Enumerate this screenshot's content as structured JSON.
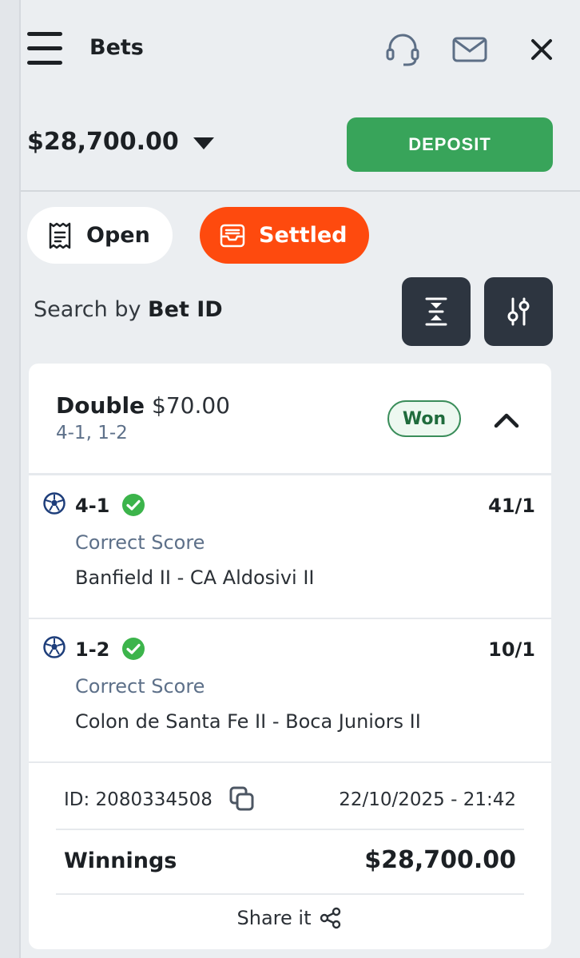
{
  "header": {
    "title": "Bets",
    "icons": [
      "menu-icon",
      "headset-icon",
      "mail-icon",
      "close-icon"
    ]
  },
  "account": {
    "balance": "$28,700.00",
    "deposit_label": "DEPOSIT"
  },
  "tabs": [
    {
      "label": "Open",
      "icon": "receipt-icon",
      "active": false
    },
    {
      "label": "Settled",
      "icon": "inbox-icon",
      "active": true
    }
  ],
  "search": {
    "prefix": "Search by ",
    "bold": "Bet ID"
  },
  "colors": {
    "deposit": "#38a45a",
    "active_tab": "#fe4a0e",
    "won_text": "#1f6b3c",
    "check": "#3cb44b",
    "dark_button": "#2d3540"
  },
  "bet": {
    "type": "Double",
    "stake": "$70.00",
    "selections_summary": "4-1, 1-2",
    "status": "Won",
    "legs": [
      {
        "pick": "4-1",
        "odds": "41/1",
        "market": "Correct Score",
        "event": "Banfield II - CA Aldosivi II",
        "sport_icon": "soccer-ball-icon",
        "result": "won"
      },
      {
        "pick": "1-2",
        "odds": "10/1",
        "market": "Correct Score",
        "event": "Colon de Santa Fe II - Boca Juniors II",
        "sport_icon": "soccer-ball-icon",
        "result": "won"
      }
    ],
    "id_label": "ID: 2080334508",
    "datetime": "22/10/2025 - 21:42",
    "winnings_label": "Winnings",
    "winnings_value": "$28,700.00",
    "share_label": "Share it"
  }
}
